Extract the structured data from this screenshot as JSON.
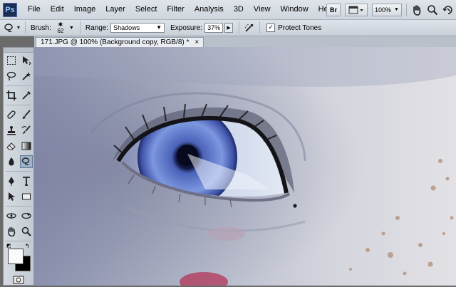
{
  "app": {
    "logo": "Ps"
  },
  "menubar": {
    "items": [
      "File",
      "Edit",
      "Image",
      "Layer",
      "Select",
      "Filter",
      "Analysis",
      "3D",
      "View",
      "Window",
      "Help"
    ],
    "zoom": "100%",
    "bridge_label": "Br"
  },
  "options": {
    "brush_label": "Brush:",
    "brush_size": "62",
    "range_label": "Range:",
    "range_value": "Shadows",
    "exposure_label": "Exposure:",
    "exposure_value": "37%",
    "protect_tones_label": "Protect Tones",
    "protect_tones_checked": true
  },
  "document": {
    "tab_title": "171.JPG @ 100% (Background copy, RGB/8) *",
    "close": "×"
  },
  "colors": {
    "foreground": "#fafafa",
    "background": "#000000"
  }
}
